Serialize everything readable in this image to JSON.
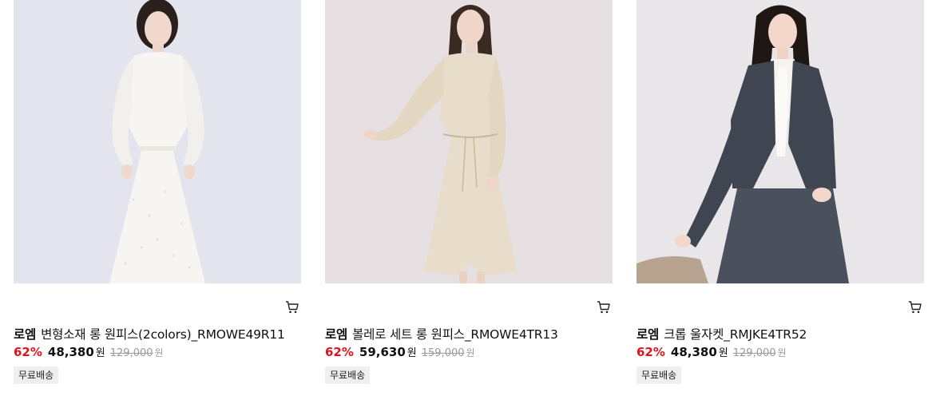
{
  "products": [
    {
      "brand": "로엠",
      "name": "변형소재 롱 원피스(2colors)_RMOWE49R11",
      "discount": "62%",
      "price": "48,380",
      "price_unit": "원",
      "original_price": "129,000",
      "original_unit": "원",
      "badge": "무료배송",
      "image_desc": "woman in white lace long dress",
      "bg_color": "#e4e4ee"
    },
    {
      "brand": "로엠",
      "name": "볼레로 세트 롱 원피스_RMOWE4TR13",
      "discount": "62%",
      "price": "59,630",
      "price_unit": "원",
      "original_price": "159,000",
      "original_unit": "원",
      "badge": "무료배송",
      "image_desc": "woman in beige bolero long dress",
      "bg_color": "#e7e0e3"
    },
    {
      "brand": "로엠",
      "name": "크롭 울자켓_RMJKE4TR52",
      "discount": "62%",
      "price": "48,380",
      "price_unit": "원",
      "original_price": "129,000",
      "original_unit": "원",
      "badge": "무료배송",
      "image_desc": "woman in grey tweed cropped jacket",
      "bg_color": "#e9e6ea"
    }
  ],
  "colors": {
    "discount": "#e0141e",
    "badge_bg": "#efefef",
    "strike": "#9a9a9a"
  }
}
